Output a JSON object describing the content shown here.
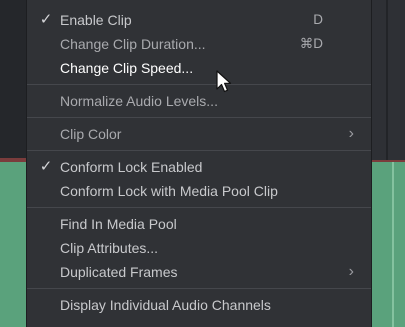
{
  "menu": {
    "items": [
      {
        "label": "Enable Clip",
        "checked": true,
        "shortcut": "D"
      },
      {
        "label": "Change Clip Duration...",
        "shortcut": "⌘D"
      },
      {
        "label": "Change Clip Speed..."
      },
      {
        "label": "Normalize Audio Levels..."
      },
      {
        "label": "Clip Color",
        "submenu": true
      },
      {
        "label": "Conform Lock Enabled",
        "checked": true
      },
      {
        "label": "Conform Lock with Media Pool Clip"
      },
      {
        "label": "Find In Media Pool"
      },
      {
        "label": "Clip Attributes..."
      },
      {
        "label": "Duplicated Frames",
        "submenu": true
      },
      {
        "label": "Display Individual Audio Channels"
      }
    ]
  },
  "glyphs": {
    "check": "✓",
    "submenu": "›"
  },
  "colors": {
    "menu_bg": "#303236",
    "clip_green": "#5aa27c",
    "clip_red_strip": "#7a3c3c"
  }
}
